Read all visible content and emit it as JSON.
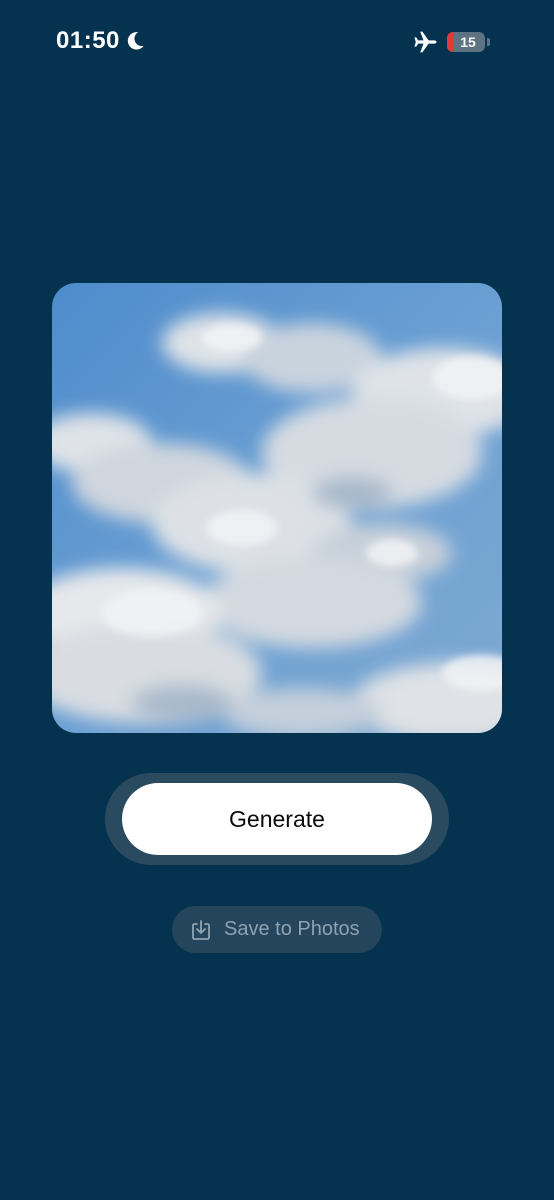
{
  "status_bar": {
    "time": "01:50",
    "focus_icon": "moon-icon",
    "airplane_icon": "airplane-icon",
    "battery_level": "15",
    "battery_color": "#e0393a"
  },
  "image": {
    "description_icon": "cloud-sky-image"
  },
  "actions": {
    "generate_label": "Generate",
    "save_label": "Save to Photos",
    "save_icon": "download-tray-icon"
  },
  "colors": {
    "background": "#04324f",
    "generate_button": "#ffffff",
    "generate_ring": "#2a4a60",
    "save_button": "#24455b",
    "save_text": "#8ea3b2",
    "sky": "#5a93cc"
  }
}
